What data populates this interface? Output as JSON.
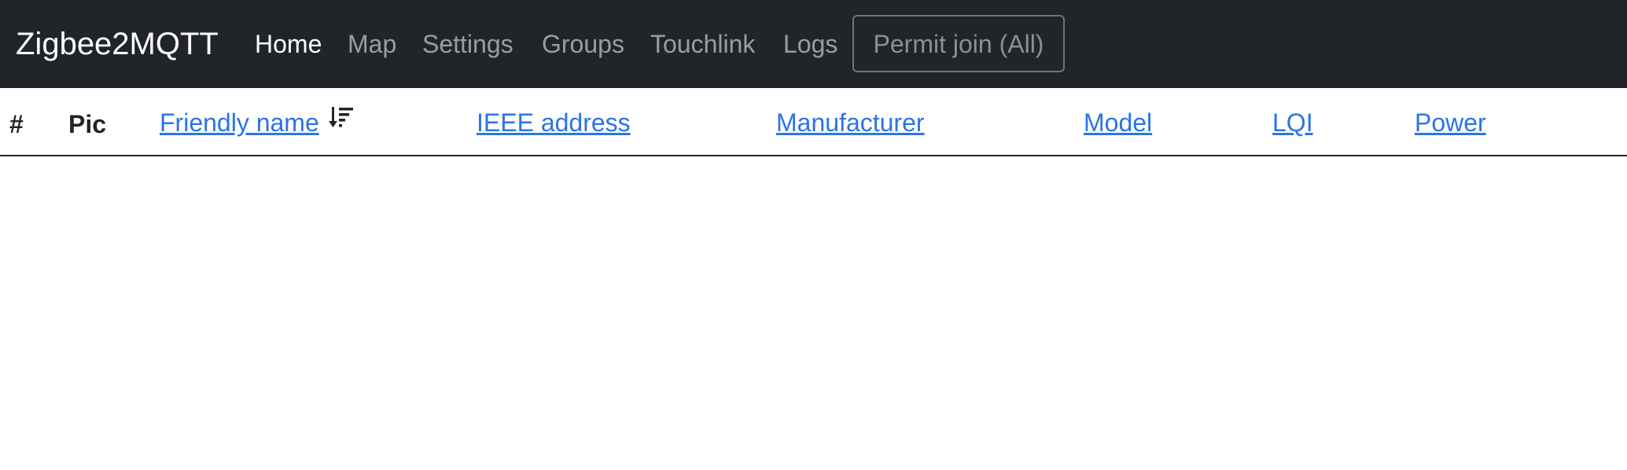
{
  "navbar": {
    "brand": "Zigbee2MQTT",
    "links": [
      {
        "label": "Home",
        "active": true
      },
      {
        "label": "Map",
        "active": false
      },
      {
        "label": "Settings",
        "active": false
      },
      {
        "label": "Groups",
        "active": false
      },
      {
        "label": "Touchlink",
        "active": false
      },
      {
        "label": "Logs",
        "active": false
      }
    ],
    "permit_join_label": "Permit join (All)"
  },
  "table": {
    "columns": [
      {
        "label": "#",
        "sortable": false
      },
      {
        "label": "Pic",
        "sortable": false
      },
      {
        "label": "Friendly name",
        "sortable": true,
        "sort_icon": "sort-descending-icon"
      },
      {
        "label": "IEEE address",
        "sortable": true
      },
      {
        "label": "Manufacturer",
        "sortable": true
      },
      {
        "label": "Model",
        "sortable": true
      },
      {
        "label": "LQI",
        "sortable": true
      },
      {
        "label": "Power",
        "sortable": true
      }
    ],
    "rows": []
  },
  "colors": {
    "navbar_bg": "#212529",
    "link": "#2a74e6",
    "active_nav": "#ffffff",
    "inactive_nav": "#8a9097"
  }
}
